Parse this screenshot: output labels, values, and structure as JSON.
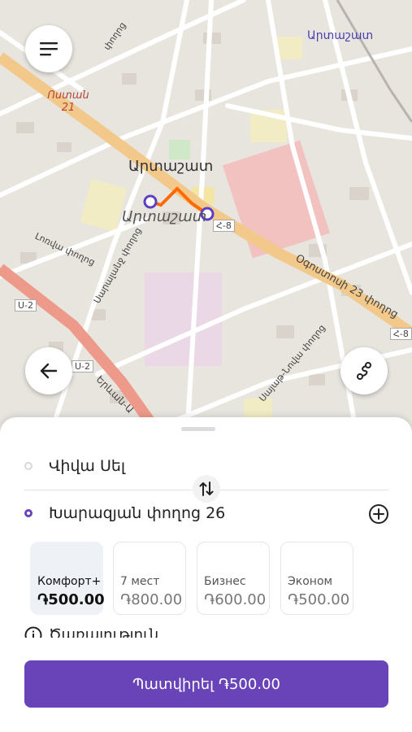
{
  "map": {
    "labels": {
      "city_top_right": "Արտաշատ",
      "district": "Ոստան 21",
      "center_label": "Արտաշատ",
      "center_label_italic": "Արտաշատ",
      "road_h8_a": "Հ-8",
      "road_h8_b": "Հ-8",
      "road_u2_a": "U-2",
      "road_u2_b": "U-2",
      "main_street": "Օգոստոսի 23 փողոց",
      "road_yerevan": "Երևան-Ա",
      "street_1": "փողոց",
      "street_2": "Սայաթ-Նովա փողոց",
      "street_3": "Լոռվա փողոց",
      "street_4": "Սարալանջ փողոց"
    },
    "route_color": "#ff6a00",
    "point_color": "#5b3fc4"
  },
  "buttons": {
    "menu_icon": "menu-icon",
    "back_icon": "arrow-left-icon",
    "route_icon": "route-icon"
  },
  "sheet": {
    "from": "Վիվա Սել",
    "to": "Խարազյան փողոց 26",
    "swap_icon": "swap-vertical-icon",
    "add_icon": "plus-circle-icon",
    "tariffs": [
      {
        "name": "Комфорт+",
        "price": "֏500.00",
        "selected": true
      },
      {
        "name": "7 мест",
        "price": "֏800.00",
        "selected": false
      },
      {
        "name": "Бизнес",
        "price": "֏600.00",
        "selected": false
      },
      {
        "name": "Эконом",
        "price": "֏500.00",
        "selected": false
      }
    ],
    "info_label": "Ծառայություն",
    "order_button": "Պատվիրել ֏500.00"
  }
}
